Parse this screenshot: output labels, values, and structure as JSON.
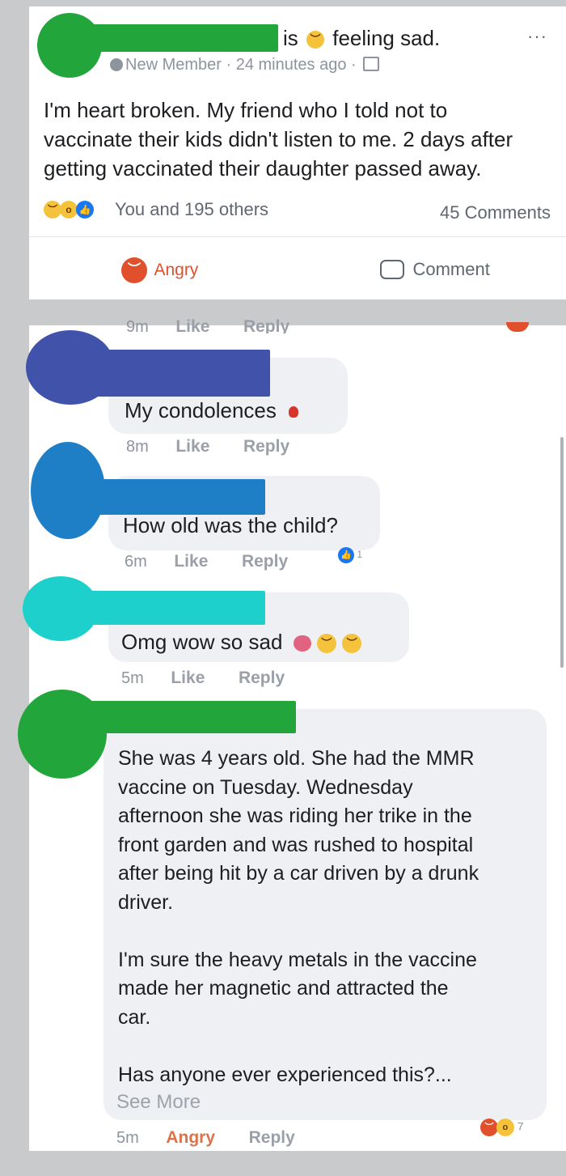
{
  "post": {
    "feeling_is": "is",
    "feeling_text": "feeling sad.",
    "options_glyph": "···",
    "meta": "New Member · 24 minutes ago ·",
    "body_lines": [
      "I'm heart broken. My friend who I told not to",
      "vaccinate their kids didn't listen to me. 2 days after",
      "getting vaccinated their daughter passed away."
    ],
    "reactions_text": "You and 195 others",
    "comments_count": "45 Comments",
    "angry_label": "Angry",
    "comment_label": "Comment"
  },
  "comments": [
    {
      "avatar_color": "#4152aa",
      "text": "",
      "time": "9m",
      "like": "Like",
      "reply": "Reply"
    },
    {
      "avatar_color": "#4152aa",
      "text": "My condolences",
      "time": "8m",
      "like": "Like",
      "reply": "Reply"
    },
    {
      "avatar_color": "#1e7fc6",
      "text": "How old was the child?",
      "time": "6m",
      "like": "Like",
      "reply": "Reply",
      "reaction_count": "1"
    },
    {
      "avatar_color": "#1dd0cc",
      "text": "Omg wow so sad",
      "time": "5m",
      "like": "Like",
      "reply": "Reply"
    },
    {
      "avatar_color": "#22a53a",
      "lines": [
        "She was 4 years old. She had the MMR",
        "vaccine on Tuesday. Wednesday",
        "afternoon she was riding her trike in the",
        "front garden and was rushed to hospital",
        "after being hit by a car driven by a drunk",
        "driver.",
        "",
        "I'm sure the heavy metals in the vaccine",
        "made her magnetic and attracted the",
        "car.",
        "",
        "Has anyone ever experienced this?..."
      ],
      "see_more": "See More",
      "time": "5m",
      "action": "Angry",
      "reply": "Reply",
      "reaction_count": "7"
    }
  ],
  "colors": {
    "redaction_green": "#22a53a",
    "angry_red": "#e0502c",
    "like_blue": "#1877f2",
    "sad_yellow": "#f5c33b"
  }
}
